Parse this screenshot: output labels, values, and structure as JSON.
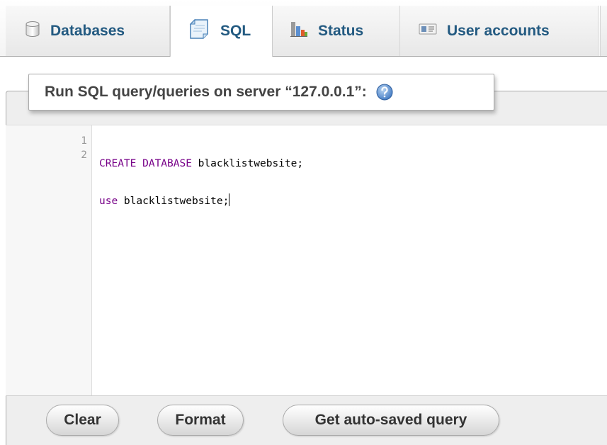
{
  "tabs": [
    {
      "label": "Databases",
      "icon": "database-icon",
      "active": false
    },
    {
      "label": "SQL",
      "icon": "sql-document-icon",
      "active": true
    },
    {
      "label": "Status",
      "icon": "status-chart-icon",
      "active": false
    },
    {
      "label": "User accounts",
      "icon": "user-accounts-icon",
      "active": false
    }
  ],
  "query_panel": {
    "legend": "Run SQL query/queries on server “127.0.0.1”:",
    "help_icon": "help-icon"
  },
  "editor": {
    "line_numbers": [
      "1",
      "2"
    ],
    "lines": [
      {
        "keyword": "CREATE DATABASE",
        "rest": " blacklistwebsite;"
      },
      {
        "keyword": "use",
        "rest": " blacklistwebsite;"
      }
    ]
  },
  "buttons": {
    "clear": "Clear",
    "format": "Format",
    "autosaved": "Get auto-saved query"
  },
  "colors": {
    "tab_text": "#235a81",
    "keyword": "#770088",
    "legend_text": "#444444"
  }
}
